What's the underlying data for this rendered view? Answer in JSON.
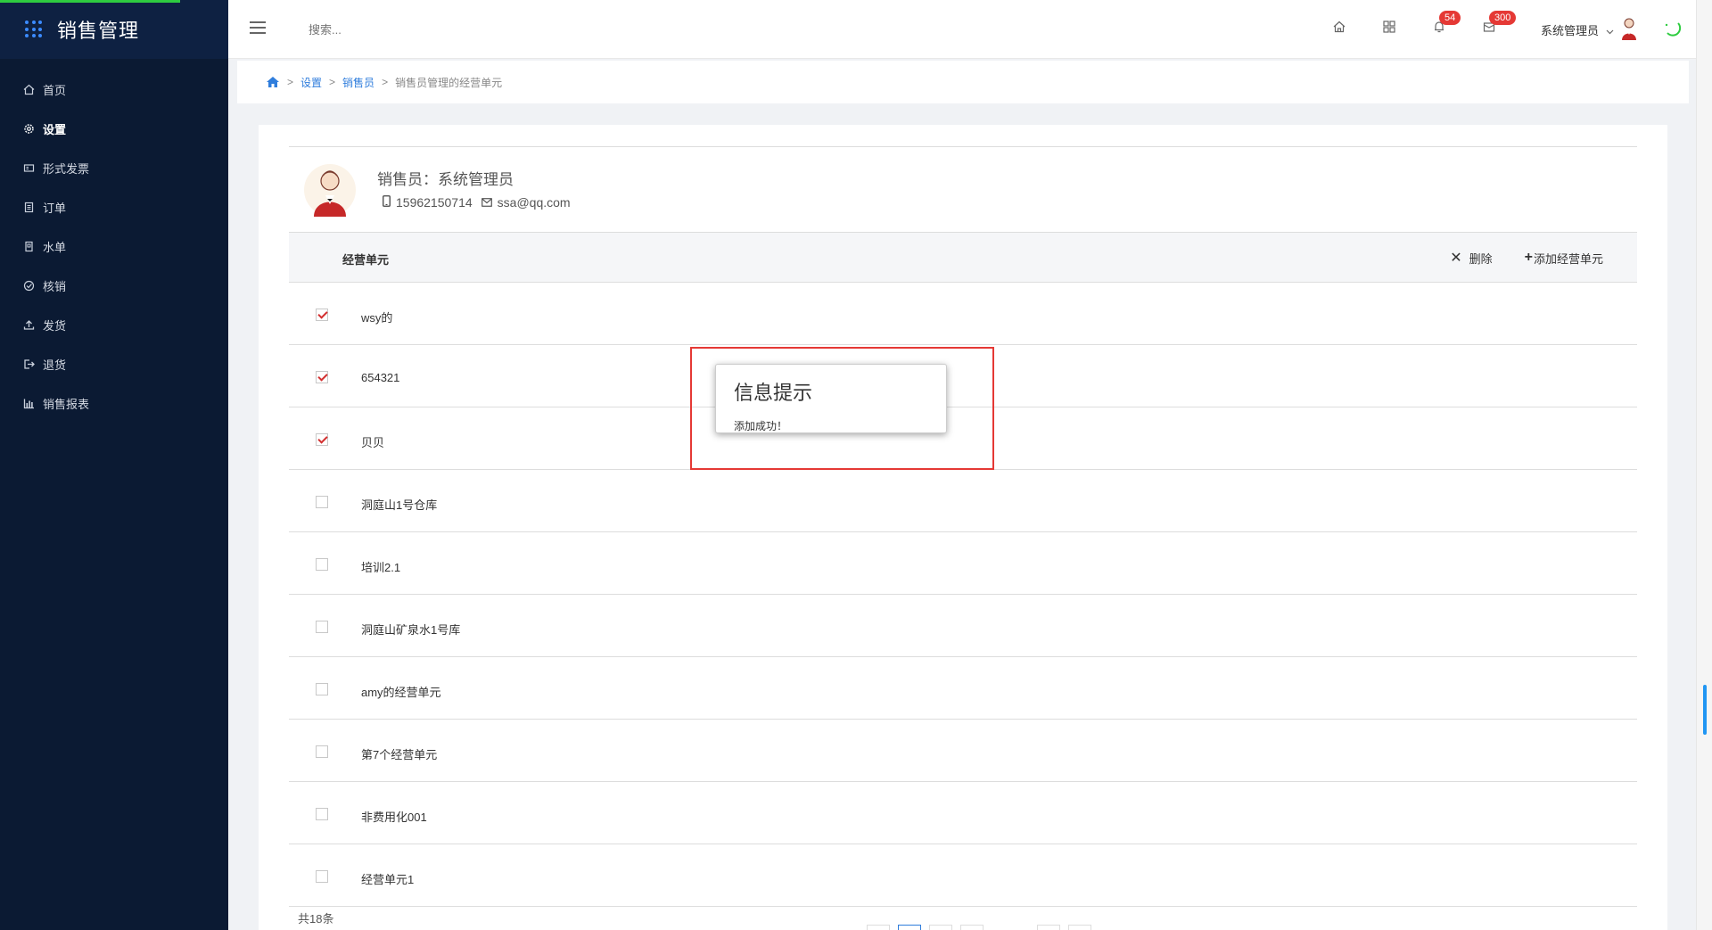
{
  "app": {
    "title": "销售管理"
  },
  "sidebar": {
    "items": [
      {
        "label": "首页",
        "icon": "home-icon"
      },
      {
        "label": "设置",
        "icon": "gear-icon",
        "active": true
      },
      {
        "label": "形式发票",
        "icon": "invoice-icon"
      },
      {
        "label": "订单",
        "icon": "order-icon"
      },
      {
        "label": "水单",
        "icon": "receipt-icon"
      },
      {
        "label": "核销",
        "icon": "check-circle-icon"
      },
      {
        "label": "发货",
        "icon": "upload-icon"
      },
      {
        "label": "退货",
        "icon": "return-icon"
      },
      {
        "label": "销售报表",
        "icon": "bar-chart-icon"
      }
    ]
  },
  "header": {
    "search_placeholder": "搜索...",
    "notification_count": "54",
    "message_count": "300",
    "user_name": "系统管理员"
  },
  "breadcrumb": {
    "items": [
      "设置",
      "销售员"
    ],
    "current": "销售员管理的经营单元"
  },
  "profile": {
    "sales_label": "销售员：系统管理员",
    "phone": "15962150714",
    "email": "ssa@qq.com"
  },
  "table": {
    "column_header": "经营单元",
    "delete_label": "删除",
    "add_label": "添加经营单元",
    "rows": [
      {
        "label": "wsy的",
        "checked": true
      },
      {
        "label": "654321",
        "checked": true
      },
      {
        "label": "贝贝",
        "checked": true
      },
      {
        "label": "洞庭山1号仓库",
        "checked": false
      },
      {
        "label": "培训2.1",
        "checked": false
      },
      {
        "label": "洞庭山矿泉水1号库",
        "checked": false
      },
      {
        "label": "amy的经营单元",
        "checked": false
      },
      {
        "label": "第7个经营单元",
        "checked": false
      },
      {
        "label": "非费用化001",
        "checked": false
      },
      {
        "label": "经营单元1",
        "checked": false
      }
    ],
    "total_label": "共18条"
  },
  "dialog": {
    "title": "信息提示",
    "message": "添加成功！"
  },
  "colors": {
    "sidebar_bg": "#0b1a33",
    "accent": "#2f7ddc",
    "badge": "#e53935",
    "highlight": "#e53935"
  }
}
